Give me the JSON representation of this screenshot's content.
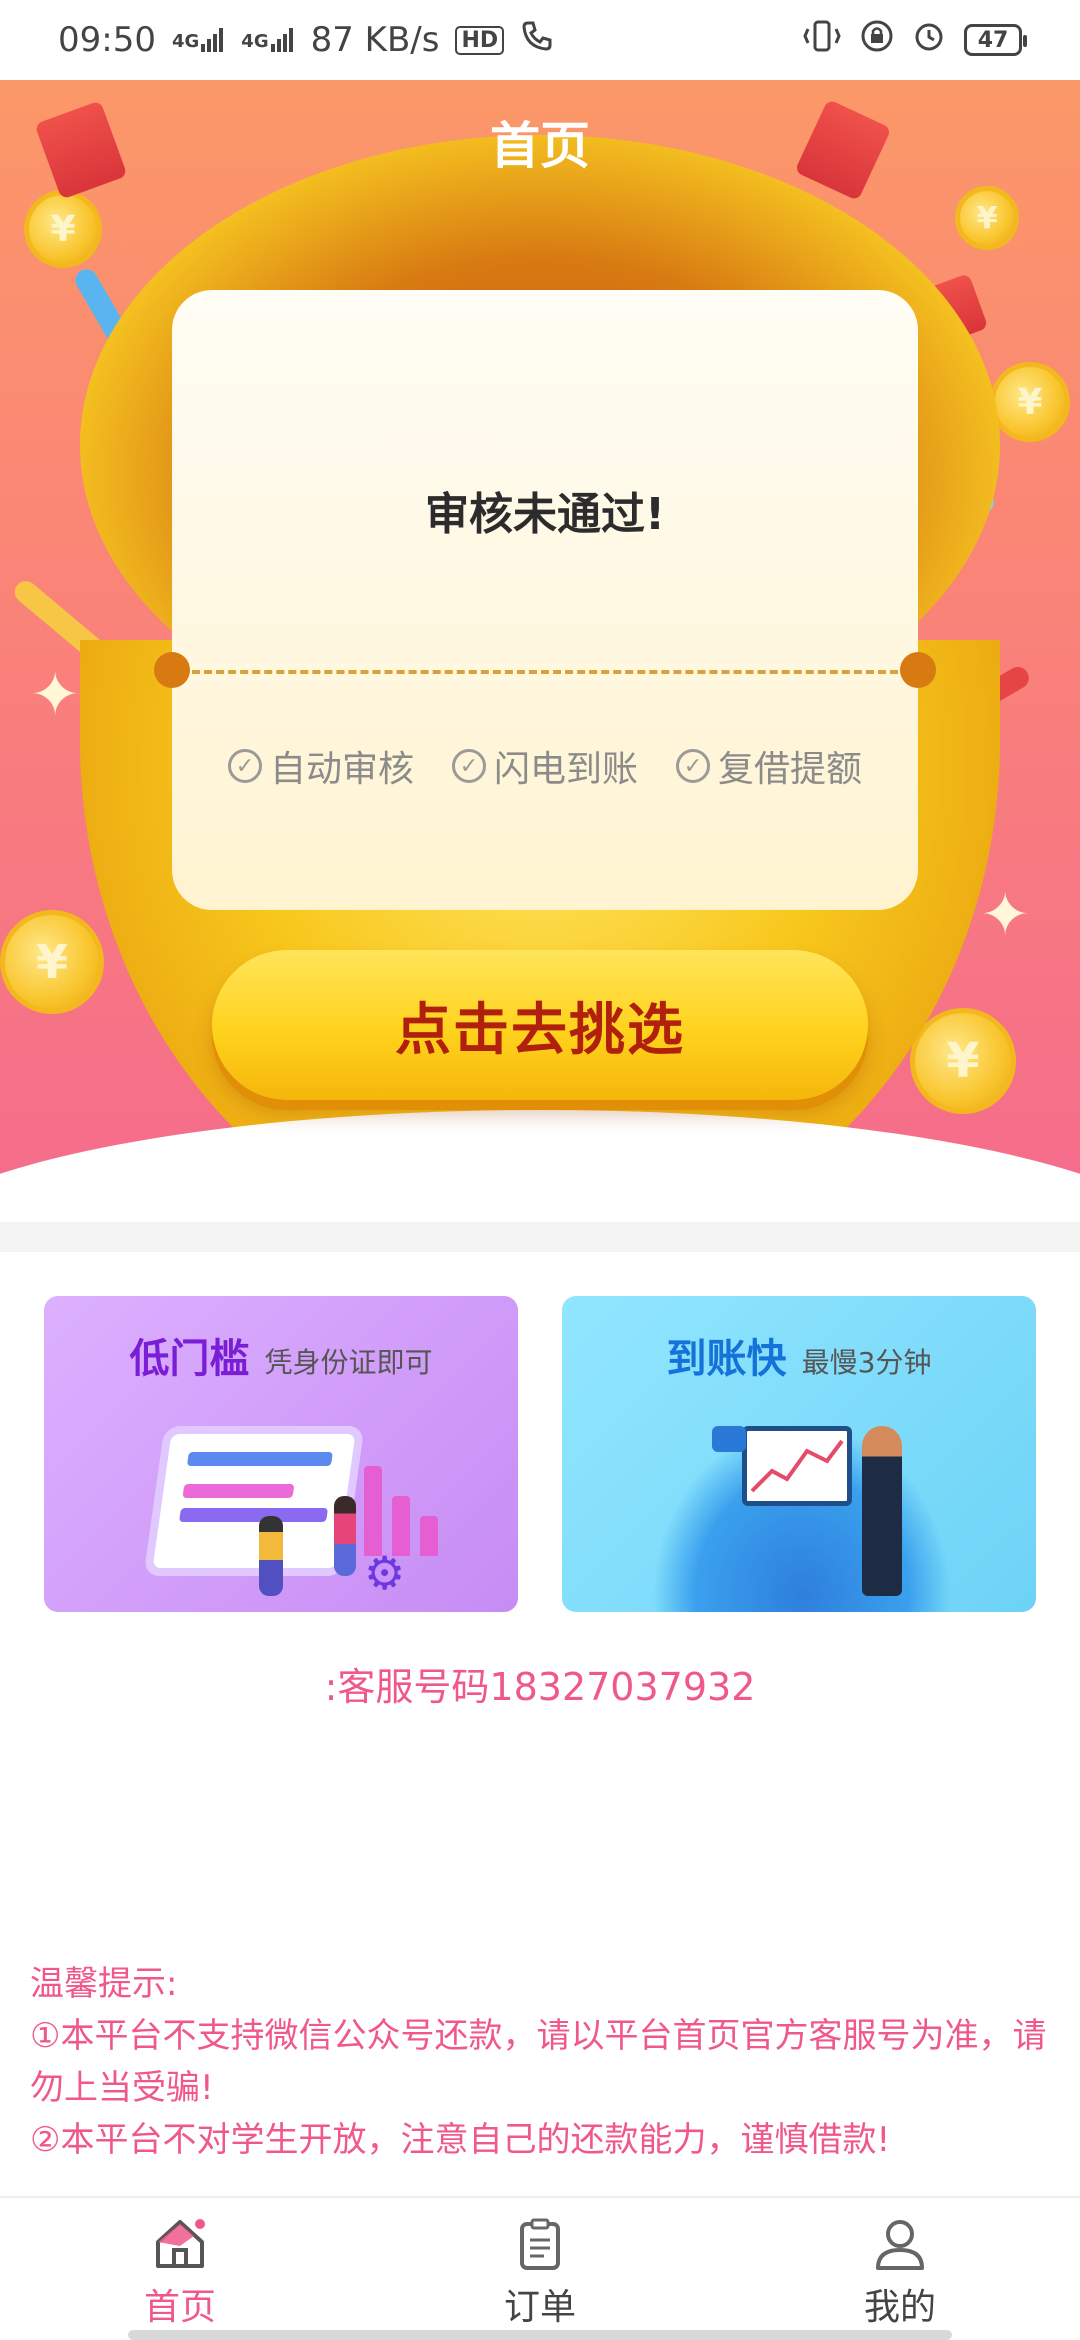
{
  "status_bar": {
    "time": "09:50",
    "net_1": "4G",
    "net_2": "4G",
    "speed": "87 KB/s",
    "hd": "HD",
    "battery": "47"
  },
  "page": {
    "title": "首页"
  },
  "card": {
    "message": "审核未通过!",
    "features": [
      "自动审核",
      "闪电到账",
      "复借提额"
    ]
  },
  "cta": {
    "label": "点击去挑选"
  },
  "coin_symbol": "¥",
  "promos": [
    {
      "title": "低门槛",
      "subtitle": "凭身份证即可"
    },
    {
      "title": "到账快",
      "subtitle": "最慢3分钟"
    }
  ],
  "hotline": ":客服号码18327037932",
  "tips": {
    "heading": "温馨提示:",
    "items": [
      "①本平台不支持微信公众号还款，请以平台首页官方客服号为准，请勿上当受骗!",
      "②本平台不对学生开放，注意自己的还款能力，谨慎借款!"
    ]
  },
  "nav": {
    "items": [
      {
        "label": "首页",
        "icon": "home-icon",
        "active": true
      },
      {
        "label": "订单",
        "icon": "clipboard-icon",
        "active": false
      },
      {
        "label": "我的",
        "icon": "user-icon",
        "active": false
      }
    ]
  },
  "colors": {
    "accent": "#f0578d",
    "cta_text": "#b0200c",
    "hero_top": "#fb9868",
    "hero_bottom": "#f56c8c"
  }
}
